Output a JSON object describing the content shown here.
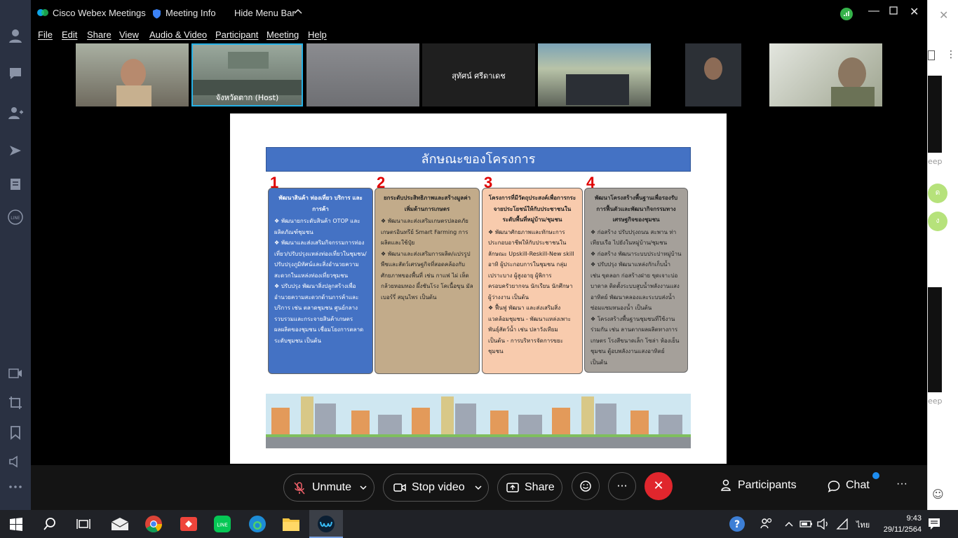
{
  "window": {
    "app_title": "Cisco Webex Meetings",
    "meeting_info": "Meeting Info",
    "hide_menu_bar": "Hide Menu Bar"
  },
  "menu": [
    "File",
    "Edit",
    "Share",
    "View",
    "Audio & Video",
    "Participant",
    "Meeting",
    "Help"
  ],
  "participants": [
    {
      "name": ""
    },
    {
      "name": "จังหวัดตาก  (Host)"
    },
    {
      "name": ""
    },
    {
      "name": "สุทัศน์ ศรีดาเดช"
    },
    {
      "name": ""
    },
    {
      "name": ""
    },
    {
      "name": ""
    }
  ],
  "slide": {
    "title": "ลักษณะของโครงการ",
    "cards": [
      {
        "number": "1",
        "heading": "พัฒนาสินค้า ท่องเที่ยว บริการ และการค้า",
        "items": [
          "พัฒนายกระดับสินค้า OTOP และผลิตภัณฑ์ชุมชน",
          "พัฒนาและส่งเสริมกิจกรรมการท่องเที่ยว/ปรับปรุงแหล่งท่องเที่ยวในชุมชน/ปรับปรุงภูมิทัศน์และสิ่งอำนวยความสะดวกในแหล่งท่องเที่ยวชุมชน",
          "ปรับปรุง พัฒนาสิ่งปลูกสร้างเพื่ออำนวยความสะดวกด้านการค้าและบริการ เช่น ตลาดชุมชน ศูนย์กลางรวบรวมและกระจายสินค้าเกษตร ผลผลิตของชุมชน เชื่อมโยงการตลาดระดับชุมชน เป็นต้น"
        ]
      },
      {
        "number": "2",
        "heading": "ยกระดับประสิทธิภาพและสร้างมูลค่าเพิ่มด้านการเกษตร",
        "items": [
          "พัฒนาและส่งเสริมเกษตรปลอดภัย เกษตรอินทรีย์ Smart Farming การผลิตและใช้ปุ๋ย",
          "พัฒนาและส่งเสริมการผลิต/แปรรูปพืชและสัตว์เศรษฐกิจที่สอดคล้องกับศักยภาพของพื้นที่ เช่น กาแฟ ไผ่ เห็ด กล้วยหอมทอง ผึ้งชันโรง โคเนื้อขุน มัลเบอร์รี่ สมุนไพร เป็นต้น"
        ]
      },
      {
        "number": "3",
        "heading": "โครงการที่มีวัตถุประสงค์เพื่อการกระจายประโยชน์ให้กับประชาชนในระดับพื้นที่หมู่บ้าน/ชุมชน",
        "items": [
          "พัฒนาศักยภาพและทักษะการประกอบอาชีพให้กับประชาชนในลักษณะ Upskill-Reskill-New skill อาทิ ผู้ประกอบการในชุมชน กลุ่มเปราะบาง ผู้สูงอายุ ผู้พิการ ครอบครัวยากจน นักเรียน นักศึกษา ผู้ว่างงาน เป็นต้น",
          "ฟื้นฟู พัฒนา และส่งเสริมสิ่งแวดล้อมชุมชน - พัฒนาแหล่งเพาะพันธุ์สัตว์น้ำ เช่น ปลาวังเทียม เป็นต้น - การบริหารจัดการขยะชุมชน"
        ]
      },
      {
        "number": "4",
        "heading": "พัฒนาโครงสร้างพื้นฐานเพื่อรองรับการฟื้นตัวและพัฒนากิจกรรมทางเศรษฐกิจของชุมชน",
        "items": [
          "ก่อสร้าง ปรับปรุงถนน สะพาน ท่าเทียบเรือ ไปยังในหมู่บ้าน/ชุมชน",
          "ก่อสร้าง พัฒนาระบบประปาหมู่บ้าน",
          "ปรับปรุง พัฒนาแหล่งกักเก็บน้ำ เช่น ขุดลอก ก่อสร้างฝาย ขุดเจาะบ่อบาดาล ติดตั้งระบบสูบน้ำพลังงานแสงอาทิตย์ พัฒนาคลองและระบบส่งน้ำ ซ่อมแซมหนองน้ำ เป็นต้น",
          "โครงสร้างพื้นฐานชุมชนที่ใช้งานร่วมกัน เช่น ลานตากผลผลิตทางการเกษตร โรงสีขนาดเล็ก โซล่า ห้องเย็นชุมชน ตู้อบพลังงานแสงอาทิตย์ เป็นต้น"
        ]
      }
    ]
  },
  "controls": {
    "unmute": "Unmute",
    "stop_video": "Stop video",
    "share": "Share",
    "participants": "Participants",
    "chat": "Chat",
    "more": "···"
  },
  "right_panel": {
    "text1": "eep",
    "text2": "eep",
    "bubble1": "ด",
    "bubble2": "ง"
  },
  "taskbar": {
    "time": "9:43",
    "date": "29/11/2564",
    "lang": "ไทย"
  },
  "colors": {
    "card1": "#4472c4",
    "card2": "#c2ab8a",
    "card3": "#f8cbad",
    "card4": "#a5a09a",
    "end_call": "#e0262d"
  }
}
